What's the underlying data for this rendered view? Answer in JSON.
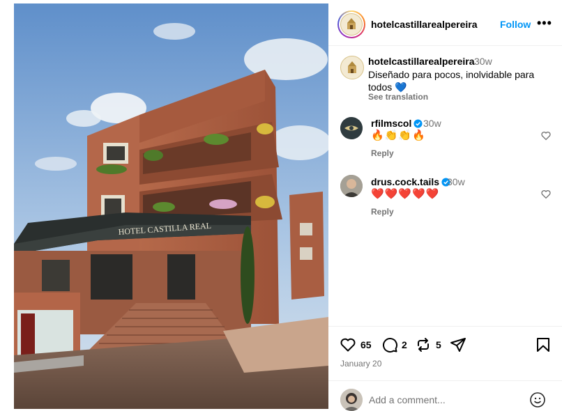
{
  "post": {
    "username": "hotelcastillarealpereira",
    "follow_label": "Follow",
    "more_label": "•••",
    "photo_sign": "HOTEL CASTILLA REAL"
  },
  "caption": {
    "username": "hotelcastillarealpereira",
    "time": "30w",
    "text": "Diseñado para pocos, inolvidable para todos 💙",
    "see_translation": "See translation"
  },
  "comments": [
    {
      "username": "rfilmscol",
      "verified": true,
      "time": "30w",
      "text": "🔥👏👏🔥",
      "reply_label": "Reply"
    },
    {
      "username": "drus.cock.tails",
      "verified": true,
      "time": "30w",
      "text": "❤️❤️❤️❤️❤️",
      "reply_label": "Reply"
    }
  ],
  "actions": {
    "likes": "65",
    "comments": "2",
    "reposts": "5"
  },
  "date": "January 20",
  "comment_box": {
    "placeholder": "Add a comment..."
  },
  "colors": {
    "accent": "#0095f6",
    "muted": "#737373",
    "verified": "#0095f6",
    "heart": "#ed4956"
  }
}
